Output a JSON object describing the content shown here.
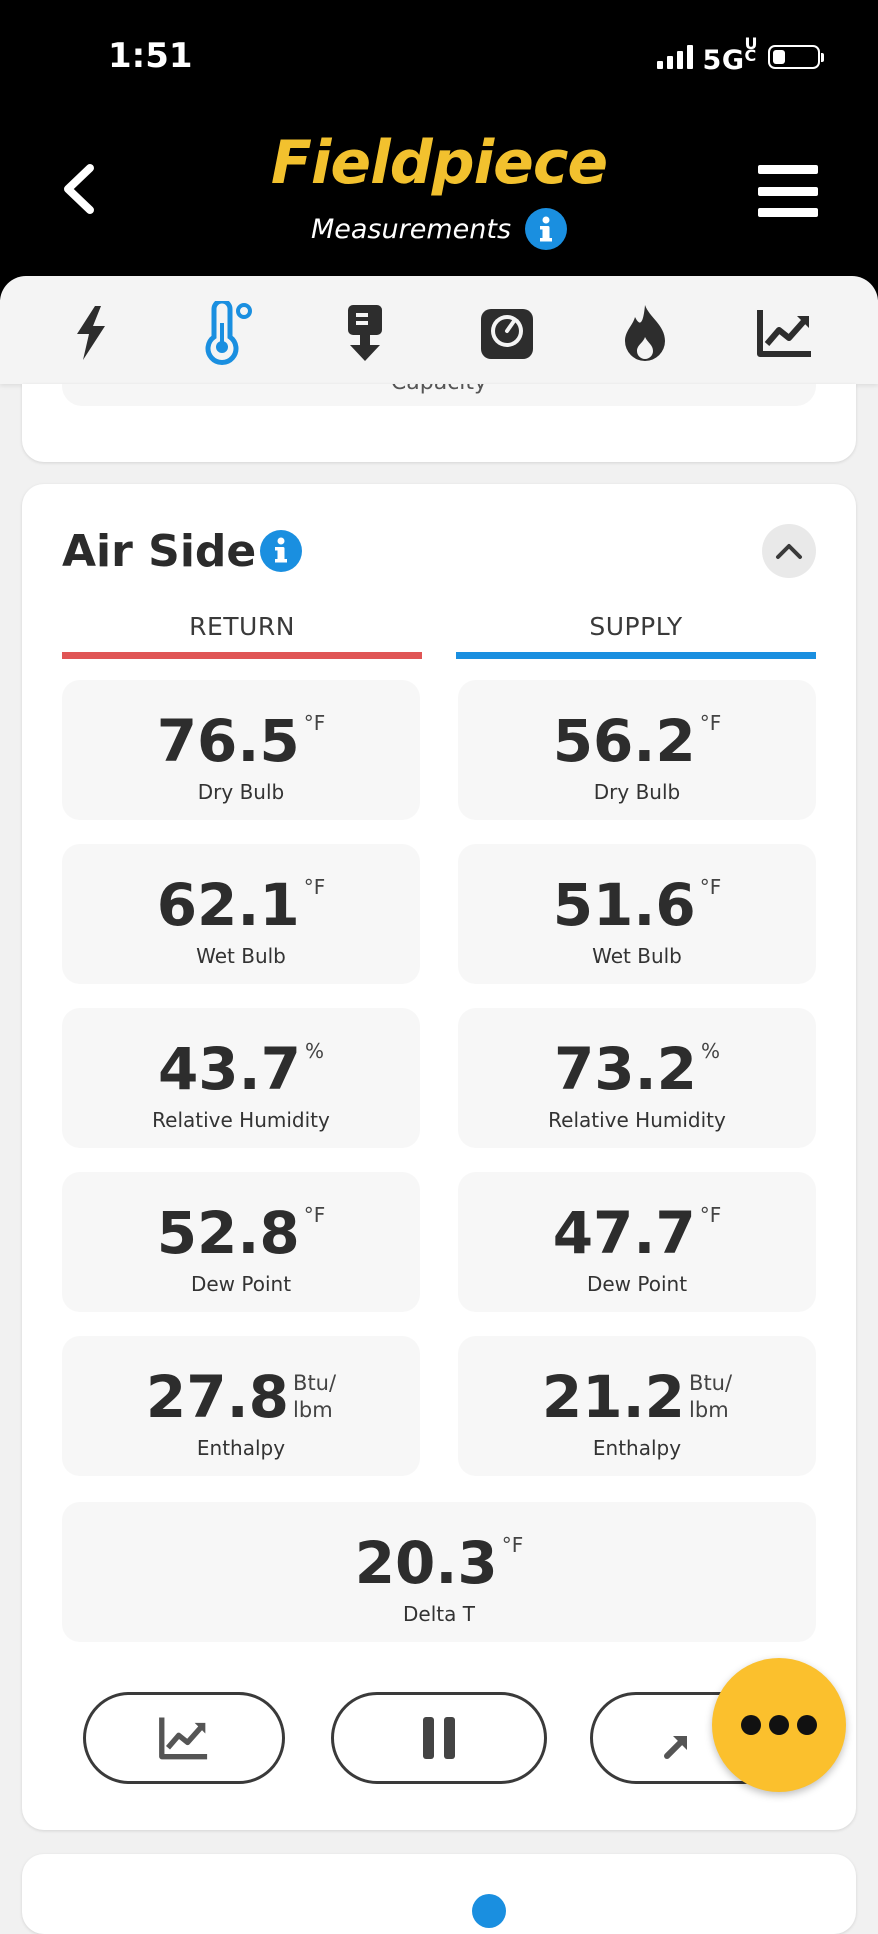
{
  "status": {
    "time": "1:51",
    "network": "5GUC",
    "battery_level": 0.3
  },
  "header": {
    "brand": "Fieldpiece",
    "subtitle": "Measurements"
  },
  "tabs": [
    {
      "icon": "bolt-icon",
      "active": false
    },
    {
      "icon": "thermometer-icon",
      "active": true
    },
    {
      "icon": "pump-icon",
      "active": false
    },
    {
      "icon": "gauge-icon",
      "active": false
    },
    {
      "icon": "flame-icon",
      "active": false
    },
    {
      "icon": "chart-icon",
      "active": false
    }
  ],
  "prev_card": {
    "cut_label": "Capacity"
  },
  "air_side": {
    "title": "Air Side",
    "return_label": "RETURN",
    "supply_label": "SUPPLY",
    "colors": {
      "return": "#e05555",
      "supply": "#1a8fe0"
    },
    "return": [
      {
        "value": "76.5",
        "unit": "°F",
        "label": "Dry Bulb"
      },
      {
        "value": "62.1",
        "unit": "°F",
        "label": "Wet Bulb"
      },
      {
        "value": "43.7",
        "unit": "%",
        "label": "Relative Humidity"
      },
      {
        "value": "52.8",
        "unit": "°F",
        "label": "Dew Point"
      },
      {
        "value": "27.8",
        "unit_top": "Btu/",
        "unit_bottom": "lbm",
        "label": "Enthalpy"
      }
    ],
    "supply": [
      {
        "value": "56.2",
        "unit": "°F",
        "label": "Dry Bulb"
      },
      {
        "value": "51.6",
        "unit": "°F",
        "label": "Wet Bulb"
      },
      {
        "value": "73.2",
        "unit": "%",
        "label": "Relative Humidity"
      },
      {
        "value": "47.7",
        "unit": "°F",
        "label": "Dew Point"
      },
      {
        "value": "21.2",
        "unit_top": "Btu/",
        "unit_bottom": "lbm",
        "label": "Enthalpy"
      }
    ],
    "delta": {
      "value": "20.3",
      "unit": "°F",
      "label": "Delta T"
    }
  },
  "actions": [
    "graph-button",
    "pause-button",
    "collapse-arrows-button"
  ],
  "accent": "#fbc02d"
}
